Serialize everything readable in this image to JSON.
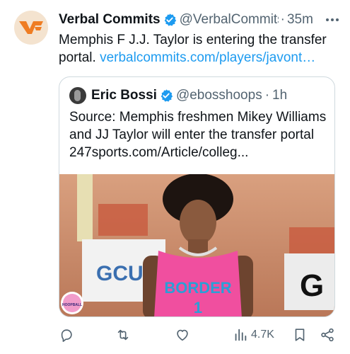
{
  "tweet": {
    "author_name": "Verbal Commits",
    "author_handle": "@VerbalCommits",
    "separator": "·",
    "time": "35m",
    "text_before_link": "Memphis F J.J. Taylor is entering the transfer portal. ",
    "link_text": "verbalcommits.com/players/javont…",
    "avatar_icon": "vc-logo-icon",
    "brand_color": "#ef7d23",
    "verified_color": "#1d9bf0"
  },
  "quote": {
    "author_name": "Eric Bossi",
    "author_handle": "@ebosshoops",
    "separator": "·",
    "time": "1h",
    "text": "Source: Memphis freshmen Mikey Williams and JJ Taylor will enter the transfer portal 247sports.com/Article/colleg...",
    "media_jersey_text": "BORDER",
    "media_jersey_number": "1",
    "media_banner_left": "GCU",
    "media_banner_right": "G",
    "media_watermark": "HOOPBALL"
  },
  "actions": {
    "reply_icon": "reply-icon",
    "retweet_icon": "retweet-icon",
    "like_icon": "like-icon",
    "views_icon": "views-icon",
    "views_count": "4.7K",
    "bookmark_icon": "bookmark-icon",
    "share_icon": "share-icon"
  }
}
